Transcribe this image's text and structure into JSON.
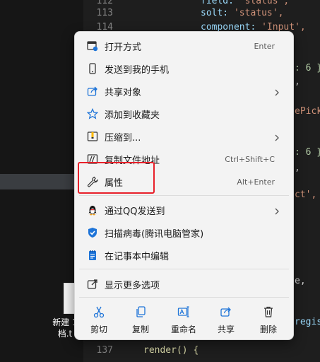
{
  "editor": {
    "line_numbers": [
      "112",
      "113",
      "114",
      "137"
    ],
    "lines": [
      {
        "key": "field:",
        "value": "'status',"
      },
      {
        "key": "solt:",
        "value": "'status',"
      },
      {
        "key": "component:",
        "value": "'Input',"
      },
      {
        "key": "",
        "value": "render() {"
      }
    ],
    "fragments": [
      ": 6 }",
      ",",
      "ePick",
      ": 6 }",
      ",",
      "ct',",
      "e,",
      "regis"
    ]
  },
  "desktop": {
    "file_label_line1": "新建 1",
    "file_label_line2": "档.t"
  },
  "menu": {
    "items": [
      {
        "label": "打开方式",
        "shortcut": "Enter",
        "icon": "open-with-icon",
        "submenu": false
      },
      {
        "label": "发送到我的手机",
        "shortcut": "",
        "icon": "phone-icon",
        "submenu": false
      },
      {
        "label": "共享对象",
        "shortcut": "",
        "icon": "share-icon",
        "submenu": true
      },
      {
        "label": "添加到收藏夹",
        "shortcut": "",
        "icon": "star-icon",
        "submenu": false
      },
      {
        "label": "压缩到...",
        "shortcut": "",
        "icon": "compress-icon",
        "submenu": true
      },
      {
        "label": "复制文件地址",
        "shortcut": "Ctrl+Shift+C",
        "icon": "copy-path-icon",
        "submenu": false
      },
      {
        "label": "属性",
        "shortcut": "Alt+Enter",
        "icon": "wrench-icon",
        "submenu": false
      },
      {
        "label": "通过QQ发送到",
        "shortcut": "",
        "icon": "qq-penguin-icon",
        "submenu": true
      },
      {
        "label": "扫描病毒(腾讯电脑管家)",
        "shortcut": "",
        "icon": "shield-icon",
        "submenu": false
      },
      {
        "label": "在记事本中编辑",
        "shortcut": "",
        "icon": "notepad-icon",
        "submenu": false
      },
      {
        "label": "显示更多选项",
        "shortcut": "",
        "icon": "more-options-icon",
        "submenu": false
      }
    ],
    "quick_actions": [
      {
        "label": "剪切",
        "icon": "scissors-icon"
      },
      {
        "label": "复制",
        "icon": "copy-icon"
      },
      {
        "label": "重命名",
        "icon": "rename-icon"
      },
      {
        "label": "共享",
        "icon": "share-icon"
      },
      {
        "label": "删除",
        "icon": "trash-icon"
      }
    ]
  },
  "colors": {
    "highlight_border": "#e8202a",
    "menu_bg": "#f3f3f3",
    "accent_blue": "#1e74d8"
  }
}
